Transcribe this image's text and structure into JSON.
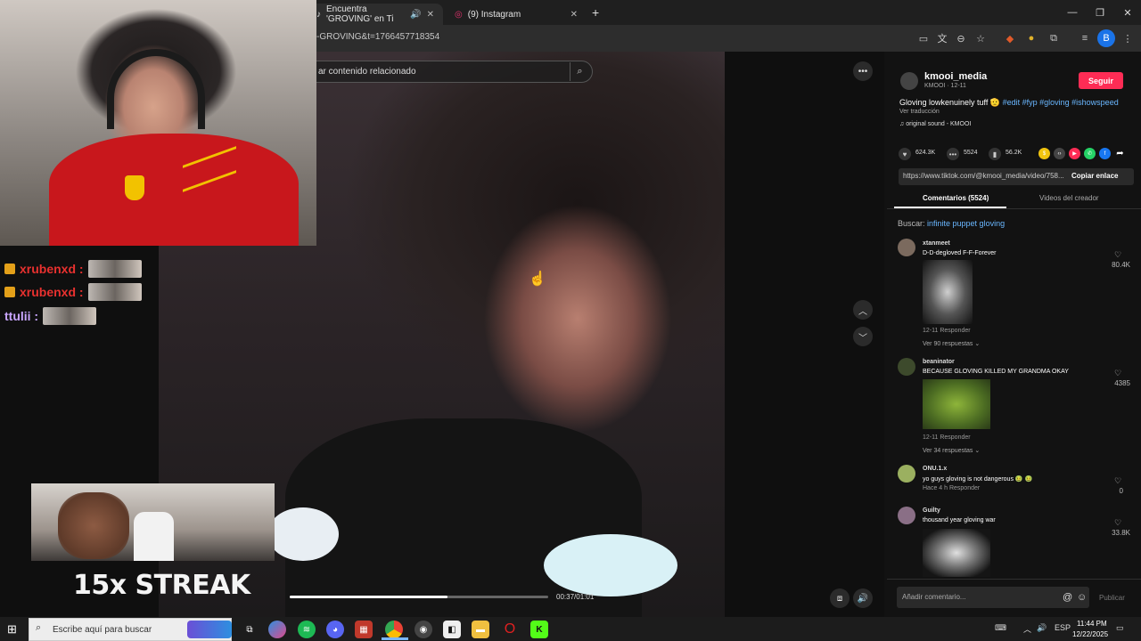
{
  "browser": {
    "tabs": [
      {
        "title": "Encuentra 'GROVING' en Ti",
        "active": true
      },
      {
        "title": "(9) Instagram",
        "active": false
      }
    ],
    "url": "-GROVING&t=1766457718354",
    "profile_initial": "B"
  },
  "video": {
    "search_placeholder": "ar contenido relacionado",
    "time": "00:37/01:01",
    "progress": 0.61
  },
  "panel": {
    "username": "kmooi_media",
    "subname": "KMOOI · 12-11",
    "follow_label": "Seguir",
    "caption_text": "Gloving lowkenuinely tuff 🫡",
    "caption_tags": " #edit #fyp #gloving #ishowspeed",
    "translate": "Ver traducción",
    "sound": "♫  original sound - KMOOI",
    "likes": "624.3K",
    "comments": "5524",
    "saves": "56.2K",
    "link": "https://www.tiktok.com/@kmooi_media/video/758...",
    "copy_link": "Copiar enlace",
    "tab_comments": "Comentarios (5524)",
    "tab_creator": "Videos del creador",
    "search_prefix": "Buscar: ",
    "search_query": "infinite puppet gloving",
    "comment_placeholder": "Añadir comentario...",
    "publish": "Publicar"
  },
  "comments": [
    {
      "user": "xtanmeet",
      "text": "D-D-degloved F-F-Forever",
      "meta": "12-11     Responder",
      "replies": "Ver 90 respuestas ⌄",
      "likes": "80.4K"
    },
    {
      "user": "beaninator",
      "text": "BECAUSE GLOVING KILLED MY GRANDMA OKAY",
      "meta": "12-11     Responder",
      "replies": "Ver 34 respuestas ⌄",
      "likes": "4385"
    },
    {
      "user": "ONU.1.x",
      "text": "yo guys gloving is not dangerous 🤢 🤢",
      "meta": "Hace 4 h     Responder",
      "likes": "0"
    },
    {
      "user": "Guilty",
      "text": "thousand year gloving war",
      "likes": "33.8K"
    }
  ],
  "stream": {
    "chat": [
      {
        "user": "xrubenxd :",
        "color": "#e8312f"
      },
      {
        "user": "xrubenxd :",
        "color": "#e8312f"
      },
      {
        "user": "ttulii :",
        "color": "#c9a6ff"
      }
    ],
    "streak": "15x STREAK"
  },
  "taskbar": {
    "search_placeholder": "Escribe aquí para buscar",
    "lang": "ESP",
    "time": "11:44 PM",
    "date": "12/22/2025"
  }
}
